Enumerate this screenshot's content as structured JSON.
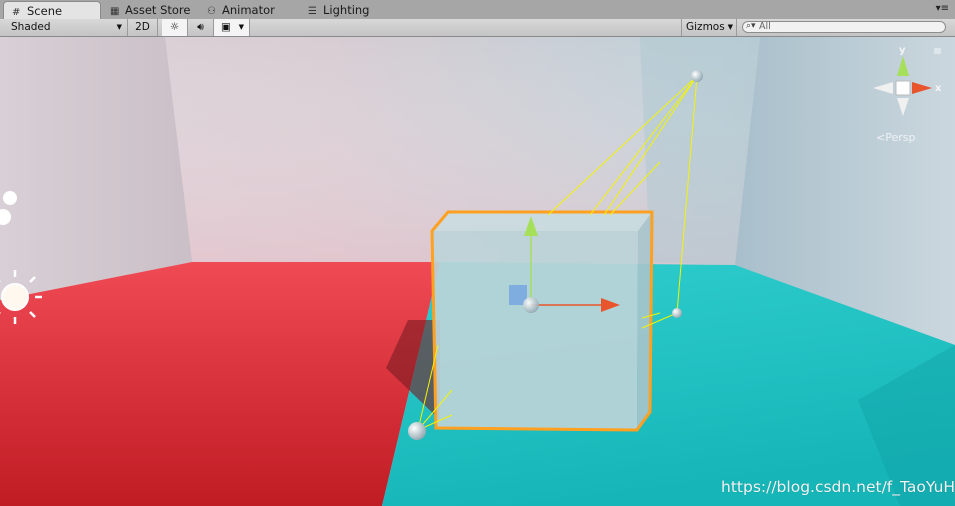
{
  "tabs": [
    {
      "label": "Scene",
      "icon": "grid-icon",
      "active": true
    },
    {
      "label": "Asset Store",
      "icon": "store-icon"
    },
    {
      "label": "Animator",
      "icon": "animator-icon"
    },
    {
      "label": "Lighting",
      "icon": "lighting-icon"
    }
  ],
  "toolbar": {
    "shading_mode": "Shaded",
    "mode_2d": "2D",
    "gizmos": "Gizmos",
    "search_placeholder": "All"
  },
  "scene_gizmo": {
    "y_label": "y",
    "x_label": "x",
    "projection": "Persp"
  },
  "watermark": "https://blog.csdn.net/f_TaoYuHu",
  "colors": {
    "floor_red": "#e8323c",
    "floor_cyan": "#22c3c3",
    "selection_outline": "#ffa020",
    "gizmo_lines": "#f4f400",
    "axis_x": "#e8542c",
    "axis_y": "#a6e05a"
  }
}
